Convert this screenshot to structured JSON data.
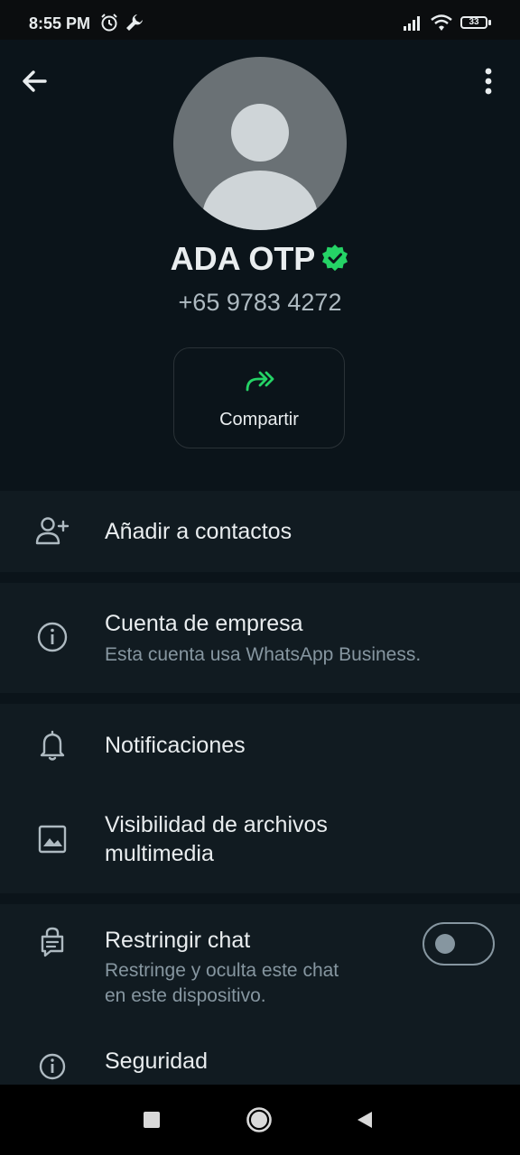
{
  "status_bar": {
    "time": "8:55 PM",
    "battery": "33",
    "icons": [
      "alarm-icon",
      "wrench-icon",
      "signal-icon",
      "wifi-icon",
      "battery-icon"
    ]
  },
  "profile": {
    "name": "ADA OTP",
    "phone": "+65 9783 4272",
    "share_label": "Compartir"
  },
  "menu": {
    "add_contacts": "Añadir a contactos",
    "business_title": "Cuenta de empresa",
    "business_sub": "Esta cuenta usa WhatsApp Business.",
    "notifications": "Notificaciones",
    "media_visibility_line1": "Visibilidad de archivos",
    "media_visibility_line2": "multimedia",
    "restrict_title": "Restringir chat",
    "restrict_sub_line1": "Restringe y oculta este chat",
    "restrict_sub_line2": "en este dispositivo.",
    "restrict_enabled": false,
    "security_title": "Seguridad"
  },
  "colors": {
    "background": "#0b141a",
    "section": "#111b21",
    "accent": "#25d366",
    "secondary_text": "#8696a0"
  }
}
